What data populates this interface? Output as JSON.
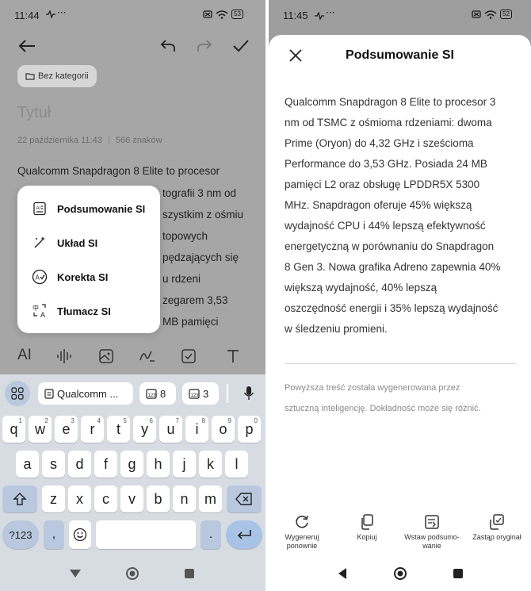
{
  "left": {
    "status": {
      "time": "11:44",
      "extra": "⋅⋅⋅",
      "battery": "53"
    },
    "toolbar": {
      "back_icon": "arrow-left-icon",
      "undo_icon": "undo-icon",
      "redo_icon": "redo-icon",
      "check_icon": "check-icon"
    },
    "category": {
      "label": "Bez kategorii",
      "icon": "folder-icon"
    },
    "note": {
      "title_placeholder": "Tytuł",
      "date": "22 października 11:43",
      "char_count": "566 znaków",
      "body_lines": [
        "Qualcomm Snapdragon 8 Elite to procesor",
        "tografii 3 nm od",
        "szystkim z ośmiu",
        "topowych",
        "pędzających się",
        "u rdzeni",
        "zegarem 3,53",
        "MB pamięci"
      ]
    },
    "ai_menu": [
      {
        "label": "Podsumowanie SI",
        "icon": "summary-icon"
      },
      {
        "label": "Układ SI",
        "icon": "magic-wand-icon"
      },
      {
        "label": "Korekta SI",
        "icon": "proofread-icon"
      },
      {
        "label": "Tłumacz SI",
        "icon": "translate-icon"
      }
    ],
    "format_bar": [
      {
        "label": "AI",
        "icon": "ai-icon"
      },
      {
        "label": "",
        "icon": "audio-icon"
      },
      {
        "label": "",
        "icon": "image-icon"
      },
      {
        "label": "",
        "icon": "draw-icon"
      },
      {
        "label": "",
        "icon": "checkbox-icon"
      },
      {
        "label": "",
        "icon": "text-format-icon"
      }
    ],
    "keyboard": {
      "suggestions": [
        {
          "label": "Qualcomm ...",
          "icon": "clipboard-icon"
        },
        {
          "label": "8",
          "icon": "number-clip-icon"
        },
        {
          "label": "3",
          "icon": "number-clip-icon"
        }
      ],
      "row1": [
        {
          "k": "q",
          "s": "1"
        },
        {
          "k": "w",
          "s": "2"
        },
        {
          "k": "e",
          "s": "3"
        },
        {
          "k": "r",
          "s": "4"
        },
        {
          "k": "t",
          "s": "5"
        },
        {
          "k": "y",
          "s": "6"
        },
        {
          "k": "u",
          "s": "7"
        },
        {
          "k": "i",
          "s": "8"
        },
        {
          "k": "o",
          "s": "9"
        },
        {
          "k": "p",
          "s": "0"
        }
      ],
      "row2": [
        "a",
        "s",
        "d",
        "f",
        "g",
        "h",
        "j",
        "k",
        "l"
      ],
      "row3": [
        "z",
        "x",
        "c",
        "v",
        "b",
        "n",
        "m"
      ],
      "sym_label": "?123",
      "comma": ",",
      "period": "."
    }
  },
  "right": {
    "status": {
      "time": "11:45",
      "extra": "⋅⋅⋅",
      "battery": "52"
    },
    "sheet": {
      "title": "Podsumowanie SI",
      "summary_lines": [
        "Qualcomm Snapdragon 8 Elite to procesor 3",
        "nm od TSMC z ośmioma rdzeniami: dwoma",
        "Prime (Oryon) do 4,32 GHz i sześcioma",
        "Performance do 3,53 GHz. Posiada 24 MB",
        "pamięci L2 oraz obsługę LPDDR5X 5300",
        "MHz. Snapdragon oferuje 45% większą",
        "wydajność CPU i 44% lepszą efektywność",
        "energetyczną w porównaniu do Snapdragon",
        "8 Gen 3. Nowa grafika Adreno zapewnia 40%",
        "większą wydajność, 40% lepszą",
        "oszczędność energii i 35% lepszą wydajność",
        "w śledzeniu promieni."
      ],
      "disclaimer_lines": [
        "Powyższa treść została wygenerowana przez",
        "sztuczną inteligencję. Dokładność może się różnić."
      ],
      "actions": [
        {
          "lines": [
            "Wygeneruj",
            "ponownie"
          ],
          "icon": "refresh-icon"
        },
        {
          "lines": [
            "Kopiuj"
          ],
          "icon": "copy-icon"
        },
        {
          "lines": [
            "Wstaw podsumo-",
            "wanie"
          ],
          "icon": "insert-icon"
        },
        {
          "lines": [
            "Zastąp oryginał"
          ],
          "icon": "replace-icon"
        }
      ]
    }
  },
  "colors": {
    "accent_blue": "#b9c8de",
    "enter_key": "#a9c3e6",
    "keyboard_bg": "#d7dce3"
  }
}
